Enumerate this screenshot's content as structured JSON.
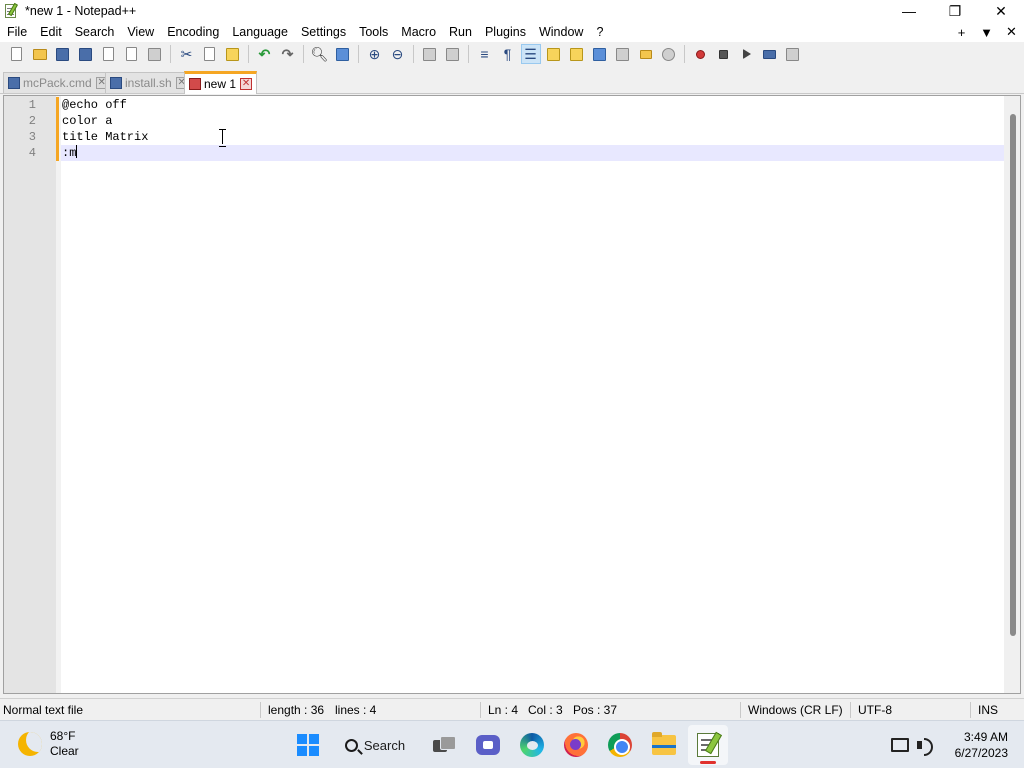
{
  "window": {
    "title": "*new 1 - Notepad++",
    "controls": {
      "minimize": "—",
      "maximize": "❐",
      "close": "✕"
    }
  },
  "menu": {
    "items": [
      "File",
      "Edit",
      "Search",
      "View",
      "Encoding",
      "Language",
      "Settings",
      "Tools",
      "Macro",
      "Run",
      "Plugins",
      "Window",
      "?"
    ],
    "right": {
      "add": "+",
      "dropdown": "▼",
      "close": "✕"
    }
  },
  "toolbar": {
    "icons": [
      "new-file-icon",
      "open-file-icon",
      "save-icon",
      "save-all-icon",
      "close-icon",
      "close-all-icon",
      "print-icon",
      "cut-icon",
      "copy-icon",
      "paste-icon",
      "undo-icon",
      "redo-icon",
      "find-icon",
      "replace-icon",
      "zoom-in-icon",
      "zoom-out-icon",
      "sync-vertical-icon",
      "sync-horizontal-icon",
      "word-wrap-icon",
      "show-all-characters-icon",
      "indent-guide-icon",
      "document-map-icon",
      "function-list-icon",
      "folder-as-workspace-icon",
      "monitoring-icon",
      "record-macro-icon",
      "stop-recording-icon",
      "playback-macro-icon",
      "run-macro-multiple-icon",
      "save-macro-icon"
    ]
  },
  "tabs": [
    {
      "label": "mcPack.cmd",
      "active": false
    },
    {
      "label": "install.sh",
      "active": false
    },
    {
      "label": "new 1",
      "active": true
    }
  ],
  "editor": {
    "lines": [
      {
        "num": "1",
        "text": "@echo off"
      },
      {
        "num": "2",
        "text": "color a"
      },
      {
        "num": "3",
        "text": "title Matrix"
      },
      {
        "num": "4",
        "text": ":m"
      }
    ],
    "current_line": 4
  },
  "status": {
    "file_type": "Normal text file",
    "length": "length : 36",
    "lines": "lines : 4",
    "ln": "Ln : 4",
    "col": "Col : 3",
    "pos": "Pos : 37",
    "eol": "Windows (CR LF)",
    "encoding": "UTF-8",
    "mode": "INS"
  },
  "taskbar": {
    "weather": {
      "temp": "68°F",
      "condition": "Clear"
    },
    "search_label": "Search",
    "clock": {
      "time": "3:49 AM",
      "date": "6/27/2023"
    }
  }
}
